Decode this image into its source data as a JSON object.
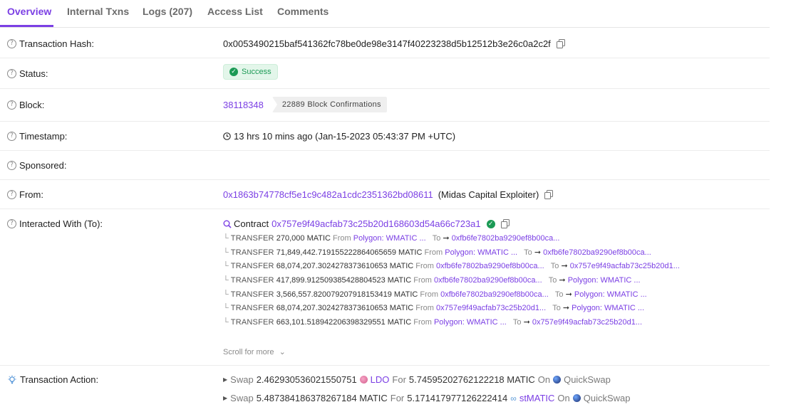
{
  "tabs": [
    {
      "label": "Overview",
      "active": true
    },
    {
      "label": "Internal Txns",
      "active": false
    },
    {
      "label": "Logs (207)",
      "active": false
    },
    {
      "label": "Access List",
      "active": false
    },
    {
      "label": "Comments",
      "active": false
    }
  ],
  "rows": {
    "hash": {
      "label": "Transaction Hash:",
      "value": "0x0053490215baf541362fc78be0de98e3147f40223238d5b12512b3e26c0a2c2f"
    },
    "status": {
      "label": "Status:",
      "value": "Success"
    },
    "block": {
      "label": "Block:",
      "value": "38118348",
      "confirmations": "22889 Block Confirmations"
    },
    "timestamp": {
      "label": "Timestamp:",
      "value": "13 hrs 10 mins ago (Jan-15-2023 05:43:37 PM +UTC)"
    },
    "sponsored": {
      "label": "Sponsored:"
    },
    "from": {
      "label": "From:",
      "address": "0x1863b74778cf5e1c9c482a1cdc2351362bd08611",
      "name": "(Midas Capital Exploiter)"
    },
    "interacted": {
      "label": "Interacted With (To):",
      "prefix": "Contract",
      "address": "0x757e9f49acfab73c25b20d168603d54a66c723a1"
    }
  },
  "transfers": [
    {
      "kind": "TRANSFER",
      "amount": "270,000 MATIC",
      "from_word": "From",
      "from": "Polygon: WMATIC ...",
      "to_word": "To",
      "to": "0xfb6fe7802ba9290ef8b00ca..."
    },
    {
      "kind": "TRANSFER",
      "amount": "71,849,442.719155222864065659 MATIC",
      "from_word": "From",
      "from": "Polygon: WMATIC ...",
      "to_word": "To",
      "to": "0xfb6fe7802ba9290ef8b00ca..."
    },
    {
      "kind": "TRANSFER",
      "amount": "68,074,207.3024278373610653 MATIC",
      "from_word": "From",
      "from": "0xfb6fe7802ba9290ef8b00ca...",
      "to_word": "To",
      "to": "0x757e9f49acfab73c25b20d1..."
    },
    {
      "kind": "TRANSFER",
      "amount": "417,899.912509385428804523 MATIC",
      "from_word": "From",
      "from": "0xfb6fe7802ba9290ef8b00ca...",
      "to_word": "To",
      "to": "Polygon: WMATIC ..."
    },
    {
      "kind": "TRANSFER",
      "amount": "3,566,557.820079207918153419 MATIC",
      "from_word": "From",
      "from": "0xfb6fe7802ba9290ef8b00ca...",
      "to_word": "To",
      "to": "Polygon: WMATIC ..."
    },
    {
      "kind": "TRANSFER",
      "amount": "68,074,207.3024278373610653 MATIC",
      "from_word": "From",
      "from": "0x757e9f49acfab73c25b20d1...",
      "to_word": "To",
      "to": "Polygon: WMATIC ..."
    },
    {
      "kind": "TRANSFER",
      "amount": "663,101.518942206398329551 MATIC",
      "from_word": "From",
      "from": "Polygon: WMATIC ...",
      "to_word": "To",
      "to": "0x757e9f49acfab73c25b20d1..."
    }
  ],
  "scroll_more": "Scroll for more",
  "action": {
    "label": "Transaction Action:",
    "lines": [
      {
        "verb": "Swap",
        "amount": "2.462930536021550751",
        "token": "LDO",
        "for": "For",
        "amount2": "5.74595202762122218 MATIC",
        "on": "On",
        "dex": "QuickSwap"
      },
      {
        "verb": "Swap",
        "amount": "5.487384186378267184 MATIC",
        "for": "For",
        "amount2": "5.171417977126222414",
        "token": "stMATIC",
        "on": "On",
        "dex": "QuickSwap"
      }
    ]
  },
  "colors": {
    "accent": "#7b3fe4",
    "success": "#1b9a55"
  }
}
